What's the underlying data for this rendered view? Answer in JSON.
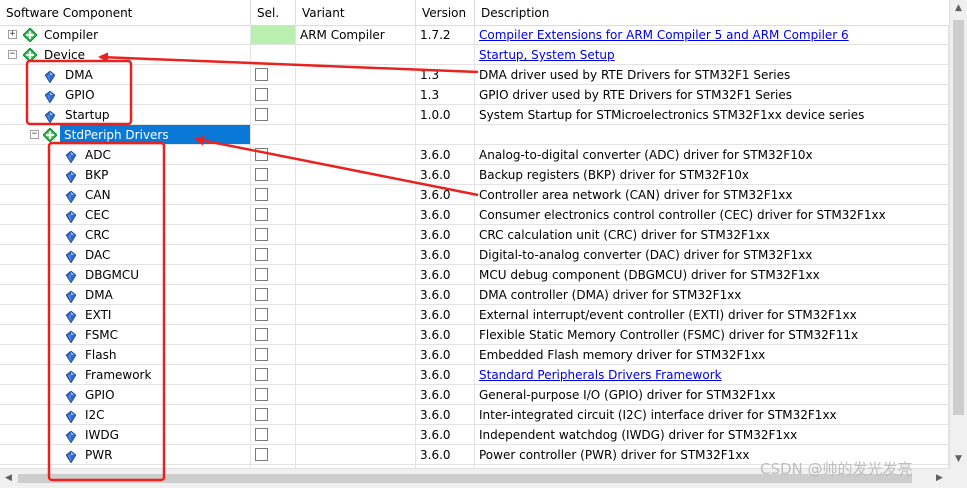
{
  "header": {
    "component": "Software Component",
    "sel": "Sel.",
    "variant": "Variant",
    "version": "Version",
    "description": "Description"
  },
  "rows": [
    {
      "name": "Compiler",
      "level": 0,
      "icon": "green-diamond-icon",
      "expander": "+",
      "sel_state": "green",
      "variant": "ARM Compiler",
      "version": "1.7.2",
      "description": "Compiler Extensions for ARM Compiler 5 and ARM Compiler 6",
      "is_link": true
    },
    {
      "name": "Device",
      "level": 0,
      "icon": "green-diamond-icon",
      "expander": "-",
      "sel_state": "none",
      "variant": "",
      "version": "",
      "description": "Startup, System Setup",
      "is_link": true
    },
    {
      "name": "DMA",
      "level": 1,
      "icon": "blue-gem-icon",
      "expander": "",
      "sel_state": "checkbox",
      "variant": "",
      "version": "1.3",
      "description": "DMA driver used by RTE Drivers for STM32F1 Series",
      "is_link": false
    },
    {
      "name": "GPIO",
      "level": 1,
      "icon": "blue-gem-icon",
      "expander": "",
      "sel_state": "checkbox",
      "variant": "",
      "version": "1.3",
      "description": "GPIO driver used by RTE Drivers for STM32F1 Series",
      "is_link": false
    },
    {
      "name": "Startup",
      "level": 1,
      "icon": "blue-gem-icon",
      "expander": "",
      "sel_state": "checkbox",
      "variant": "",
      "version": "1.0.0",
      "description": "System Startup for STMicroelectronics STM32F1xx device series",
      "is_link": false
    },
    {
      "name": "StdPeriph Drivers",
      "level": 1,
      "icon": "green-diamond-icon",
      "expander": "-",
      "sel_state": "none",
      "variant": "",
      "version": "",
      "description": "",
      "is_link": false,
      "selected": true
    },
    {
      "name": "ADC",
      "level": 2,
      "icon": "blue-gem-icon",
      "expander": "",
      "sel_state": "checkbox",
      "variant": "",
      "version": "3.6.0",
      "description": "Analog-to-digital converter (ADC) driver for STM32F10x",
      "is_link": false
    },
    {
      "name": "BKP",
      "level": 2,
      "icon": "blue-gem-icon",
      "expander": "",
      "sel_state": "checkbox",
      "variant": "",
      "version": "3.6.0",
      "description": "Backup registers (BKP) driver for STM32F10x",
      "is_link": false
    },
    {
      "name": "CAN",
      "level": 2,
      "icon": "blue-gem-icon",
      "expander": "",
      "sel_state": "checkbox",
      "variant": "",
      "version": "3.6.0",
      "description": "Controller area network (CAN) driver for STM32F1xx",
      "is_link": false
    },
    {
      "name": "CEC",
      "level": 2,
      "icon": "blue-gem-icon",
      "expander": "",
      "sel_state": "checkbox",
      "variant": "",
      "version": "3.6.0",
      "description": "Consumer electronics control controller (CEC) driver for STM32F1xx",
      "is_link": false
    },
    {
      "name": "CRC",
      "level": 2,
      "icon": "blue-gem-icon",
      "expander": "",
      "sel_state": "checkbox",
      "variant": "",
      "version": "3.6.0",
      "description": "CRC calculation unit (CRC) driver for STM32F1xx",
      "is_link": false
    },
    {
      "name": "DAC",
      "level": 2,
      "icon": "blue-gem-icon",
      "expander": "",
      "sel_state": "checkbox",
      "variant": "",
      "version": "3.6.0",
      "description": "Digital-to-analog converter (DAC) driver for STM32F1xx",
      "is_link": false
    },
    {
      "name": "DBGMCU",
      "level": 2,
      "icon": "blue-gem-icon",
      "expander": "",
      "sel_state": "checkbox",
      "variant": "",
      "version": "3.6.0",
      "description": "MCU debug component (DBGMCU) driver for STM32F1xx",
      "is_link": false
    },
    {
      "name": "DMA",
      "level": 2,
      "icon": "blue-gem-icon",
      "expander": "",
      "sel_state": "checkbox",
      "variant": "",
      "version": "3.6.0",
      "description": "DMA controller (DMA) driver for STM32F1xx",
      "is_link": false
    },
    {
      "name": "EXTI",
      "level": 2,
      "icon": "blue-gem-icon",
      "expander": "",
      "sel_state": "checkbox",
      "variant": "",
      "version": "3.6.0",
      "description": "External interrupt/event controller (EXTI) driver for STM32F1xx",
      "is_link": false
    },
    {
      "name": "FSMC",
      "level": 2,
      "icon": "blue-gem-icon",
      "expander": "",
      "sel_state": "checkbox",
      "variant": "",
      "version": "3.6.0",
      "description": "Flexible Static Memory Controller (FSMC) driver for STM32F11x",
      "is_link": false
    },
    {
      "name": "Flash",
      "level": 2,
      "icon": "blue-gem-icon",
      "expander": "",
      "sel_state": "checkbox",
      "variant": "",
      "version": "3.6.0",
      "description": "Embedded Flash memory driver for STM32F1xx",
      "is_link": false
    },
    {
      "name": "Framework",
      "level": 2,
      "icon": "blue-gem-icon",
      "expander": "",
      "sel_state": "checkbox",
      "variant": "",
      "version": "3.6.0",
      "description": "Standard Peripherals Drivers Framework",
      "is_link": true
    },
    {
      "name": "GPIO",
      "level": 2,
      "icon": "blue-gem-icon",
      "expander": "",
      "sel_state": "checkbox",
      "variant": "",
      "version": "3.6.0",
      "description": "General-purpose I/O (GPIO) driver for STM32F1xx",
      "is_link": false
    },
    {
      "name": "I2C",
      "level": 2,
      "icon": "blue-gem-icon",
      "expander": "",
      "sel_state": "checkbox",
      "variant": "",
      "version": "3.6.0",
      "description": "Inter-integrated circuit (I2C) interface driver for STM32F1xx",
      "is_link": false
    },
    {
      "name": "IWDG",
      "level": 2,
      "icon": "blue-gem-icon",
      "expander": "",
      "sel_state": "checkbox",
      "variant": "",
      "version": "3.6.0",
      "description": "Independent watchdog (IWDG) driver for STM32F1xx",
      "is_link": false
    },
    {
      "name": "PWR",
      "level": 2,
      "icon": "blue-gem-icon",
      "expander": "",
      "sel_state": "checkbox",
      "variant": "",
      "version": "3.6.0",
      "description": "Power controller (PWR) driver for STM32F1xx",
      "is_link": false
    }
  ],
  "scrollbars": {
    "up_arrow": "▲",
    "down_arrow": "▼",
    "left_arrow": "◀",
    "right_arrow": "▶"
  },
  "colors": {
    "selected_row": "#0a78d7",
    "sel_green": "#b9f0b0",
    "link": "#0000e6",
    "annotation_red": "#e8231f",
    "diamond_green": "#22b14c"
  },
  "watermark": "CSDN @帅的发光发亮"
}
